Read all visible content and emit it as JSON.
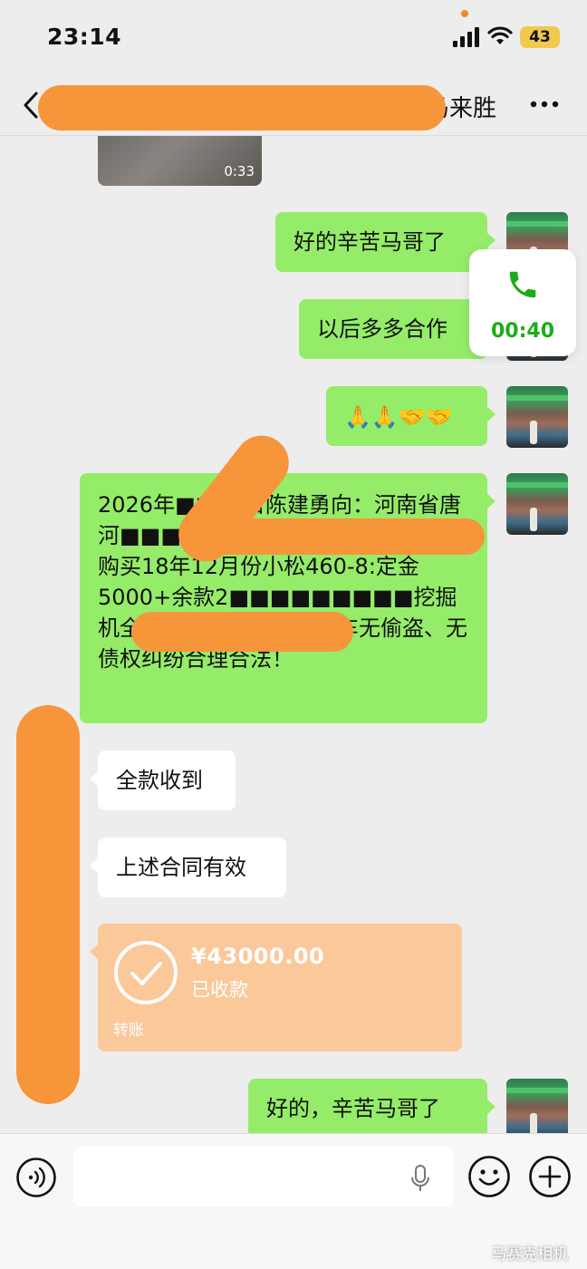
{
  "status_bar": {
    "time": "23:14",
    "battery": "43"
  },
  "header": {
    "title": "马来胜"
  },
  "video": {
    "duration": "0:33"
  },
  "call": {
    "duration": "00:40"
  },
  "messages": [
    {
      "text": "好的辛苦马哥了"
    },
    {
      "text": "以后多多合作"
    },
    {
      "text": "🙏🙏🤝🤝"
    },
    {
      "text": "2026年■■15日陈建勇向：河南省唐河■■■■■17号：■■来胜、好兄弟购买18年12月份小松460-8:定金5000+余款2■■■■■■■■■挖掘机全款已一次付、保证此车无偷盗、无债权纠纷合理合法！"
    },
    {
      "text": "全款收到"
    },
    {
      "text": "上述合同有效"
    },
    {
      "text": "好的，辛苦马哥了"
    }
  ],
  "transfer": {
    "amount": "¥43000.00",
    "status": "已收款",
    "label": "转账"
  },
  "input": {
    "placeholder": ""
  },
  "watermark": "马赛克相机",
  "colors": {
    "sent_bubble": "#95ec69",
    "received_bubble": "#ffffff",
    "transfer_card": "#fbc89a",
    "redaction": "#f7953a"
  }
}
